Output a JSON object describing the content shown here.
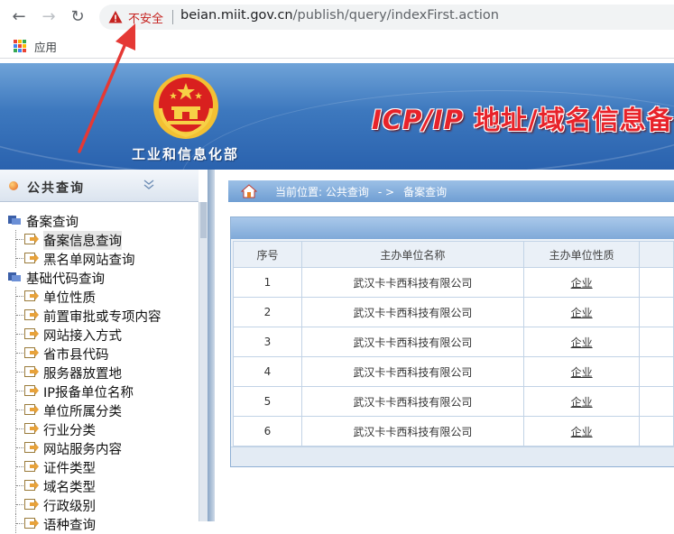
{
  "browser": {
    "back_glyph": "←",
    "forward_glyph": "→",
    "reload_glyph": "↻",
    "insecure_label": "不安全",
    "url_host": "beian.miit.gov.cn",
    "url_path": "/publish/query/indexFirst.action",
    "apps_label": "应用"
  },
  "header": {
    "ministry_name": "工业和信息化部",
    "title_icp": "ICP/IP",
    "title_rest": " 地址/域名信息备"
  },
  "sidebar": {
    "title": "公共查询",
    "items": [
      {
        "label": "备案查询",
        "level": 0
      },
      {
        "label": "备案信息查询",
        "level": 1,
        "active": true
      },
      {
        "label": "黑名单网站查询",
        "level": 1
      },
      {
        "label": "基础代码查询",
        "level": 0
      },
      {
        "label": "单位性质",
        "level": 1
      },
      {
        "label": "前置审批或专项内容",
        "level": 1
      },
      {
        "label": "网站接入方式",
        "level": 1
      },
      {
        "label": "省市县代码",
        "level": 1
      },
      {
        "label": "服务器放置地",
        "level": 1
      },
      {
        "label": "IP报备单位名称",
        "level": 1
      },
      {
        "label": "单位所属分类",
        "level": 1
      },
      {
        "label": "行业分类",
        "level": 1
      },
      {
        "label": "网站服务内容",
        "level": 1
      },
      {
        "label": "证件类型",
        "level": 1
      },
      {
        "label": "域名类型",
        "level": 1
      },
      {
        "label": "行政级别",
        "level": 1
      },
      {
        "label": "语种查询",
        "level": 1
      }
    ]
  },
  "breadcrumb": {
    "prefix": "当前位置: 公共查询",
    "separator": "- >",
    "current": "备案查询"
  },
  "table": {
    "headers": [
      "序号",
      "主办单位名称",
      "主办单位性质",
      ""
    ],
    "rows": [
      {
        "seq": "1",
        "name": "武汉卡卡西科技有限公司",
        "type": "企业"
      },
      {
        "seq": "2",
        "name": "武汉卡卡西科技有限公司",
        "type": "企业"
      },
      {
        "seq": "3",
        "name": "武汉卡卡西科技有限公司",
        "type": "企业"
      },
      {
        "seq": "4",
        "name": "武汉卡卡西科技有限公司",
        "type": "企业"
      },
      {
        "seq": "5",
        "name": "武汉卡卡西科技有限公司",
        "type": "企业"
      },
      {
        "seq": "6",
        "name": "武汉卡卡西科技有限公司",
        "type": "企业"
      }
    ]
  },
  "colors": {
    "insecure": "#c5221f",
    "header_blue": "#3d78be",
    "title_red": "#e8232a",
    "annotation_arrow": "#e53935"
  }
}
